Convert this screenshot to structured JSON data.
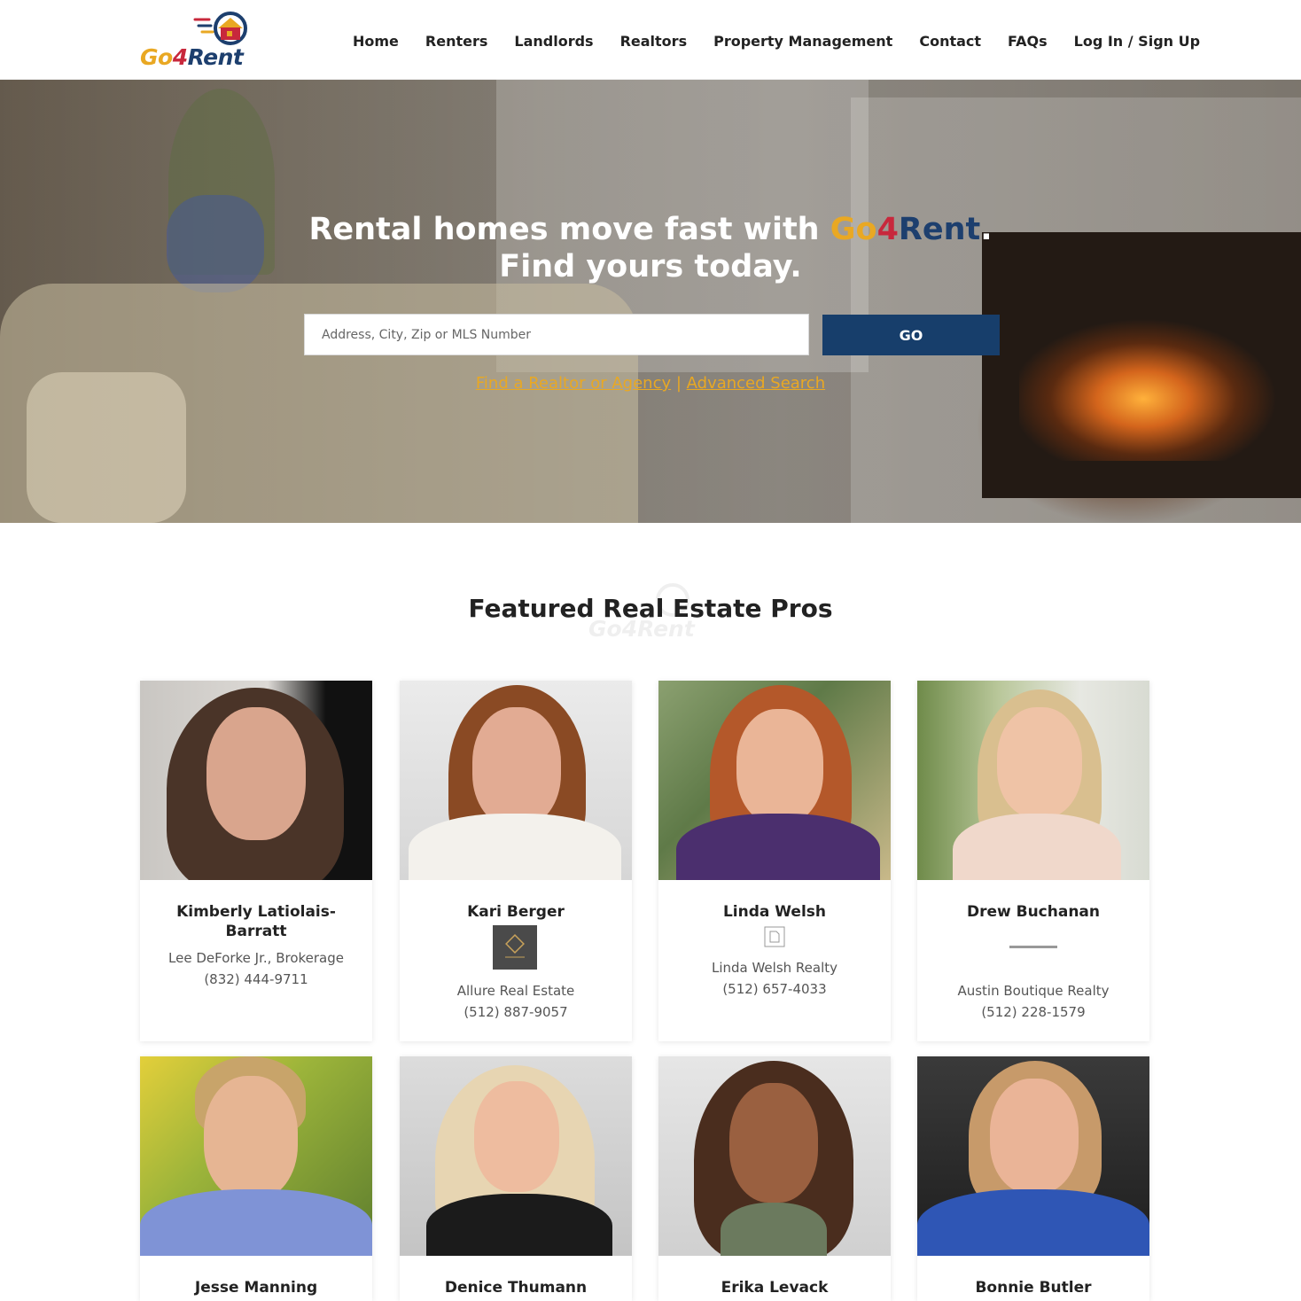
{
  "brand": {
    "go": "Go",
    "four": "4",
    "rent": "Rent"
  },
  "nav": {
    "items": [
      {
        "label": "Home"
      },
      {
        "label": "Renters"
      },
      {
        "label": "Landlords"
      },
      {
        "label": "Realtors"
      },
      {
        "label": "Property Management"
      },
      {
        "label": "Contact"
      },
      {
        "label": "FAQs"
      },
      {
        "label": "Log In / Sign Up"
      }
    ]
  },
  "hero": {
    "title_prefix": "Rental homes move fast with ",
    "title_suffix": ".",
    "title_line2": "Find yours today.",
    "search_placeholder": "Address, City, Zip or MLS Number",
    "go_label": "GO",
    "link_realtor": "Find a Realtor or Agency",
    "link_separator": " | ",
    "link_advanced": "Advanced Search"
  },
  "featured": {
    "title": "Featured Real Estate Pros",
    "watermark": "Go4Rent",
    "pros": [
      {
        "name_line1": "Kimberly Latiolais-",
        "name_line2": "Barratt",
        "company": "Lee DeForke Jr., Brokerage",
        "phone": "(832) 444-9711"
      },
      {
        "name_line1": "Kari Berger",
        "company": "Allure Real Estate",
        "phone": "(512) 887-9057"
      },
      {
        "name_line1": "Linda Welsh",
        "company": "Linda Welsh Realty",
        "phone": "(512) 657-4033"
      },
      {
        "name_line1": "Drew Buchanan",
        "company": "Austin Boutique Realty",
        "phone": "(512) 228-1579"
      },
      {
        "name_line1": "Jesse Manning"
      },
      {
        "name_line1": "Denice Thumann"
      },
      {
        "name_line1": "Erika Levack"
      },
      {
        "name_line1": "Bonnie Butler"
      }
    ]
  },
  "colors": {
    "brand_gold": "#e9a823",
    "brand_red": "#c8283c",
    "brand_navy": "#1d3f6e",
    "button_navy": "#173e6b"
  },
  "icons": {
    "logo": "house-in-circle-icon",
    "agency_logo_kari": "allure-logo-icon",
    "agency_logo_linda": "broken-image-icon"
  }
}
